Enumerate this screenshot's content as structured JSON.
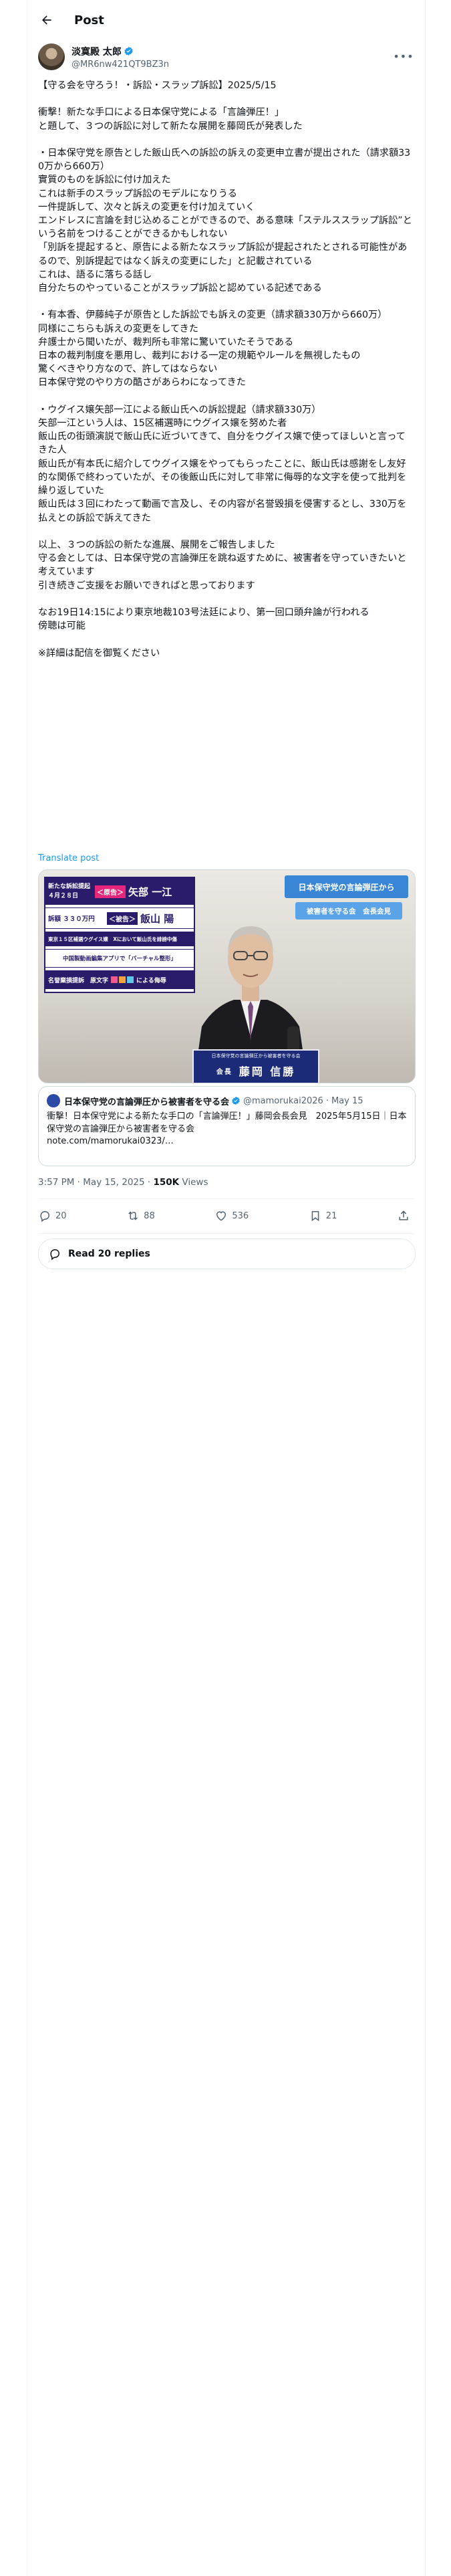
{
  "topbar": {
    "title": "Post"
  },
  "author": {
    "display_name": "淡寞殿 太郎",
    "handle": "@MR6nw421QT9BZ3n",
    "verified_color": "#1d9bf0"
  },
  "post": {
    "text": "【守る会を守ろう！・訴訟・スラップ訴訟】2025/5/15\n\n衝撃！新たな手口による日本保守党による「言論弾圧！」\nと題して、３つの訴訟に対して新たな展開を藤岡氏が発表した\n\n・日本保守党を原告とした飯山氏への訴訟の訴えの変更申立書が提出された（請求額330万から660万）\n實質のものを訴訟に付け加えた\nこれは新手のスラップ訴訟のモデルになりうる\n一件提訴して、次々と訴えの変更を付け加えていく\nエンドレスに言論を封じ込めることができるので、ある意味「ステルススラップ訴訟”という名前をつけることができるかもしれない\n「別訴を提起すると、原告による新たなスラップ訴訟が提起されたとされる可能性があるので、別訴提起ではなく訴えの変更にした」と記載されている\nこれは、語るに落ちる話し\n自分たちのやっていることがスラップ訴訟と認めている記述である\n\n・有本香、伊藤純子が原告とした訴訟でも訴えの変更（請求額330万から660万）\n同様にこちらも訴えの変更をしてきた\n弁護士から聞いたが、裁判所も非常に驚いていたそうである\n日本の裁判制度を悪用し、裁判における一定の規範やルールを無視したもの\n驚くべきやり方なので、許してはならない\n日本保守党のやり方の酷さがあらわになってきた\n\n・ウグイス嬢矢部一江による飯山氏への訴訟提起（請求額330万）\n矢部一江という人は、15区補選時にウグイス嬢を努めた者\n飯山氏の街頭演説で飯山氏に近づいてきて、自分をウグイス嬢で使ってほしいと言ってきた人\n飯山氏が有本氏に紹介してウグイス嬢をやってもらったことに、飯山氏は感謝をし友好的な関係で終わっていたが、その後飯山氏に対して非常に侮辱的な文字を使って批判を繰り返していた\n飯山氏は３回にわたって動画で言及し、その内容が名誉毀損を侵害するとし、330万を払えとの訴訟で訴えてきた\n\n以上、３つの訴訟の新たな進展、展開をご報告しました\n守る会としては、日本保守党の言論弾圧を跳ね返すために、被害者を守っていきたいと考えています\n引き続きご支援をお願いできればと思っております\n\nなお19日14:15により東京地裁103号法廷により、第一回口頭弁論が行われる\n傍聴は可能\n\n※詳細は配信を御覧ください",
    "translate_label": "Translate post"
  },
  "media": {
    "left_panel": {
      "header_line1": "新たな訴訟提起",
      "header_date": "４月２８日",
      "header_tag": "＜原告＞",
      "header_name": "矢部 一江",
      "line2_prefix": "訴額 ３３０万円",
      "line2_tag": "＜被告＞",
      "line2_name": "飯山 陽",
      "line3": "東京１５区補選ウグイス嬢　Xにおいて飯山氏を誹謗中傷",
      "line4": "中国製動画編集アプリで「バーチャル整形」",
      "line5_prefix": "名誉棄損提訴　原文字",
      "line5_suffix": "による侮辱"
    },
    "banner_main": "日本保守党の言論弾圧から",
    "banner_sub": "被害者を守る会　会長会見",
    "podium_caption": "日本保守党の言論弾圧から被害者を守る会",
    "podium_role": "会長",
    "podium_name": "藤岡 信勝"
  },
  "quote": {
    "name": "日本保守党の言論弾圧から被害者を守る会",
    "handle": "@mamorukai2026",
    "date": "May 15",
    "text": "衝撃！日本保守党による新たな手口の「言論弾圧！」藤岡会長会見　2025年5月15日｜日本保守党の言論弾圧から被害者を守る会\nnote.com/mamorukai0323/…"
  },
  "meta": {
    "time": "3:57 PM · May 15, 2025 · ",
    "views_count": "150K",
    "views_label": " Views"
  },
  "actions": {
    "replies": "20",
    "reposts": "88",
    "likes": "536",
    "bookmarks": "21"
  },
  "read_replies": "Read 20 replies"
}
